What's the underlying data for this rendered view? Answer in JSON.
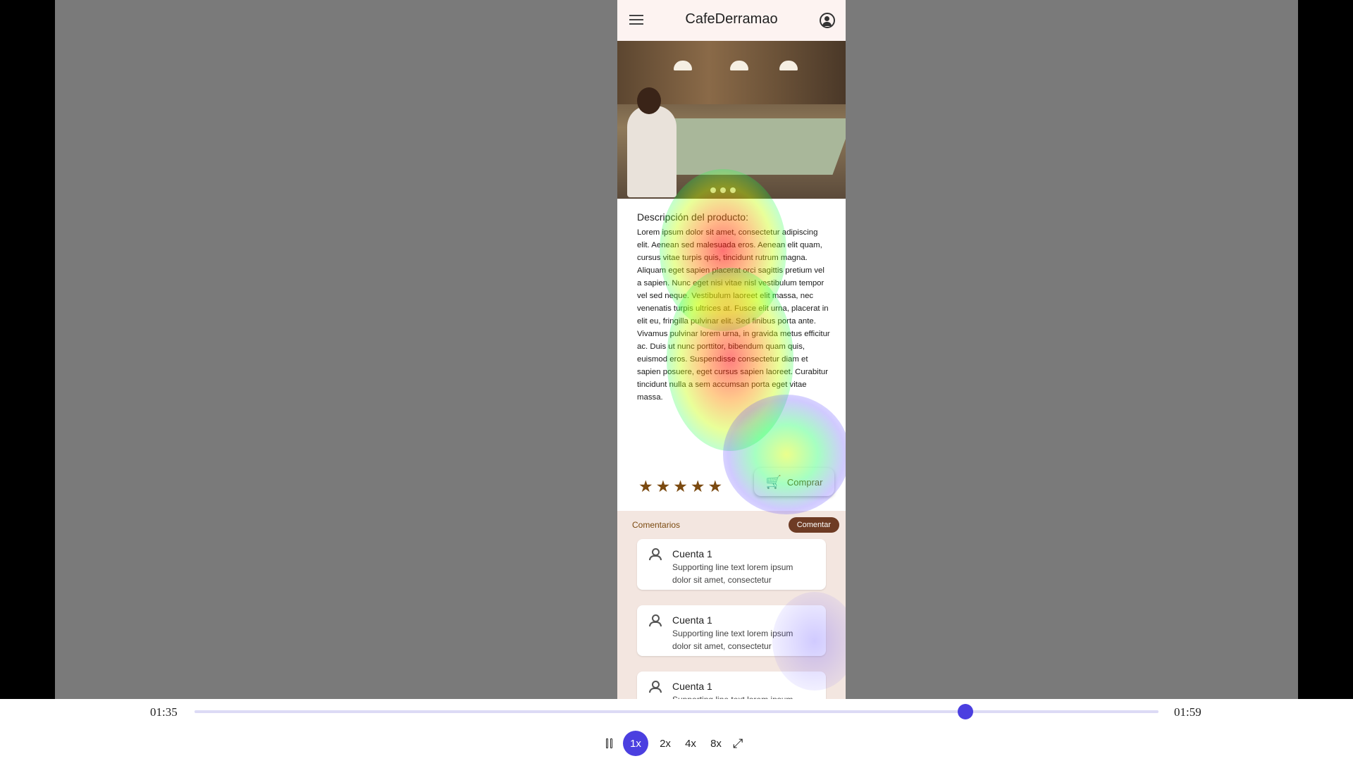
{
  "app": {
    "title": "CafeDerramao",
    "menu_icon": "menu-icon",
    "account_icon": "account-circle-icon"
  },
  "product": {
    "description_heading": "Descripción del producto:",
    "description_text": "Lorem ipsum dolor sit amet, consectetur adipiscing elit. Aenean sed malesuada eros. Aenean elit quam, cursus vitae turpis quis, tincidunt rutrum magna. Aliquam eget sapien placerat orci sagittis pretium vel a sapien. Nunc eget nisi vitae nisl vestibulum tempor vel sed neque. Vestibulum laoreet elit massa, nec venenatis turpis ultrices at. Fusce elit urna, placerat in elit eu, fringilla pulvinar elit. Sed finibus porta ante. Vivamus pulvinar lorem urna, in gravida metus efficitur ac. Duis ut nunc porttitor, bibendum quam quis, euismod eros. Suspendisse consectetur diam et sapien posuere, eget cursus sapien laoreet. Curabitur tincidunt nulla a sem accumsan porta eget vitae massa.",
    "rating": 5,
    "rating_max": 5,
    "buy_label": "Comprar",
    "carousel_dots": 3
  },
  "comments": {
    "heading": "Comentarios",
    "add_label": "Comentar",
    "items": [
      {
        "name": "Cuenta 1",
        "text": "Supporting line text lorem ipsum dolor sit amet, consectetur"
      },
      {
        "name": "Cuenta 1",
        "text": "Supporting line text lorem ipsum dolor sit amet, consectetur"
      },
      {
        "name": "Cuenta 1",
        "text": "Supporting line text lorem ipsum"
      }
    ]
  },
  "player": {
    "current_time": "01:35",
    "total_time": "01:59",
    "progress": 0.8,
    "speeds": [
      "1x",
      "2x",
      "4x",
      "8x"
    ],
    "active_speed": "1x"
  },
  "colors": {
    "accent": "#4b3fe0",
    "brand_brown": "#6e3b24",
    "star": "#7b4a10"
  }
}
